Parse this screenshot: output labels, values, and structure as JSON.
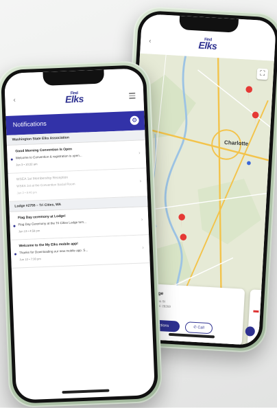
{
  "map_phone": {
    "logo": "Elks",
    "logo_small": "Find",
    "back_symbol": "‹",
    "expand_symbol": "⛶",
    "city_label": "Charlotte",
    "card": {
      "title": "Lodge",
      "line1": "Princess St",
      "line2": "Hills, NC 28269",
      "directions_label": "Directions",
      "call_label": "Call",
      "call_icon": "phone-icon"
    },
    "colors": {
      "pin": "#e53935",
      "brand": "#2e3190"
    }
  },
  "notifications_phone": {
    "logo": "Elks",
    "logo_small": "Find",
    "back_symbol": "‹",
    "header_title": "Notifications",
    "gear_symbol": "⚙",
    "sections": [
      {
        "name": "Washington State Elks Association",
        "items": [
          {
            "title": "Good Morning Convention Is Open",
            "body": "Welcome to Convention & registration is open...",
            "time": "Jun 3 • 10:22 am",
            "unread": true
          },
          {
            "title": "WSEA 1st Membership Reception",
            "body": "WSEA 1st at the Convention Social Room",
            "time": "Jun 2 • 8:40 pm",
            "unread": false
          }
        ]
      },
      {
        "name": "Lodge #2755 – Tri Cities, WA",
        "items": [
          {
            "title": "Flag Day ceremony at Lodge!",
            "body": "Flag Day Ceremony at the Tri Cities Lodge tom...",
            "time": "Jun 13 • 4:58 pm",
            "unread": true
          },
          {
            "title": "Welcome to the My Elks mobile app!",
            "body": "Thanks for Downloading our new mobile app. S...",
            "time": "Jun 12 • 7:30 pm",
            "unread": true
          }
        ]
      }
    ],
    "chevron": "›"
  }
}
